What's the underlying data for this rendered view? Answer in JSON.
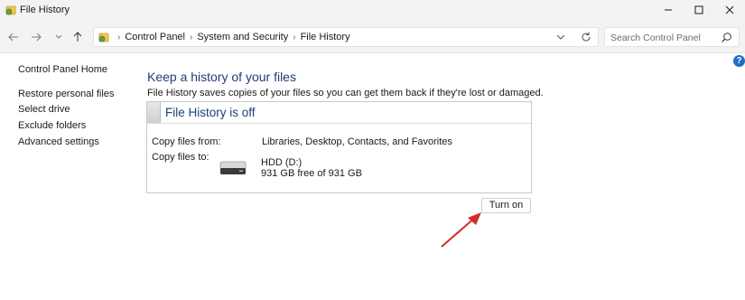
{
  "window": {
    "title": "File History",
    "controls": {
      "minimize": "minimize-icon",
      "maximize": "maximize-icon",
      "close": "close-icon"
    }
  },
  "nav": {
    "breadcrumbs": [
      "Control Panel",
      "System and Security",
      "File History"
    ],
    "search_placeholder": "Search Control Panel",
    "icons": [
      "back-arrow-icon",
      "forward-arrow-icon",
      "recent-chevron-icon",
      "up-arrow-icon",
      "control-panel-icon",
      "address-dropdown-icon",
      "refresh-icon",
      "search-icon"
    ]
  },
  "help": {
    "label": "?"
  },
  "sidebar": {
    "home": "Control Panel Home",
    "links": [
      "Restore personal files",
      "Select drive",
      "Exclude folders",
      "Advanced settings"
    ]
  },
  "main": {
    "heading": "Keep a history of your files",
    "description": "File History saves copies of your files so you can get them back if they're lost or damaged.",
    "status": "File History is off",
    "copy_from_label": "Copy files from:",
    "copy_from_value": "Libraries, Desktop, Contacts, and Favorites",
    "copy_to_label": "Copy files to:",
    "drive_name": "HDD (D:)",
    "drive_free": "931 GB free of 931 GB",
    "turn_on_label": "Turn on"
  },
  "annotation": {
    "arrow_color": "#d42b2b"
  },
  "colors": {
    "heading": "#1e3f78",
    "help": "#1d6fc4"
  }
}
